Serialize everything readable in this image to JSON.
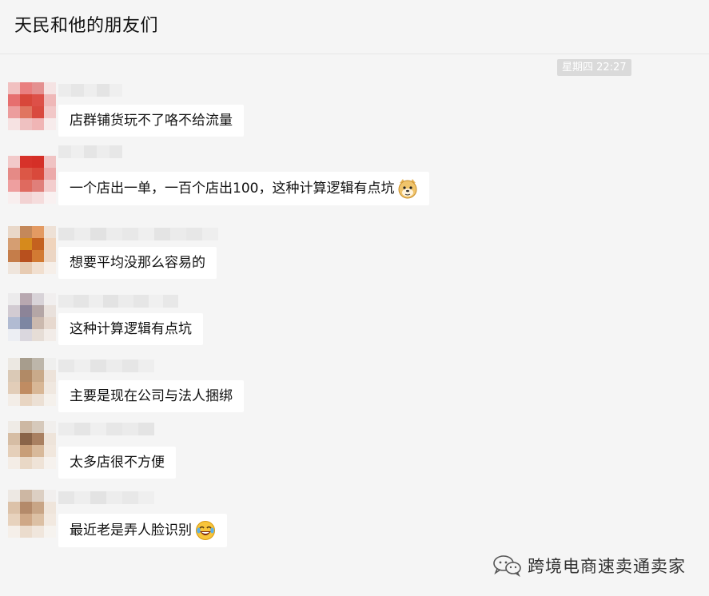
{
  "header": {
    "title": "天民和他的朋友们"
  },
  "time_badge": "星期四 22:27",
  "messages": [
    {
      "text": "店群铺货玩不了咯不给流量",
      "emoji": ""
    },
    {
      "text": "一个店出一单，一百个店出100，这种计算逻辑有点坑",
      "emoji": "doge-face-icon"
    },
    {
      "text": "想要平均没那么容易的",
      "emoji": ""
    },
    {
      "text": "这种计算逻辑有点坑",
      "emoji": ""
    },
    {
      "text": "主要是现在公司与法人捆绑",
      "emoji": ""
    },
    {
      "text": "太多店很不方便",
      "emoji": ""
    },
    {
      "text": "最近老是弄人脸识别",
      "emoji": "laughing-crying-face-icon"
    }
  ],
  "watermark": {
    "text": "跨境电商速卖通卖家",
    "icon": "wechat-icon"
  }
}
